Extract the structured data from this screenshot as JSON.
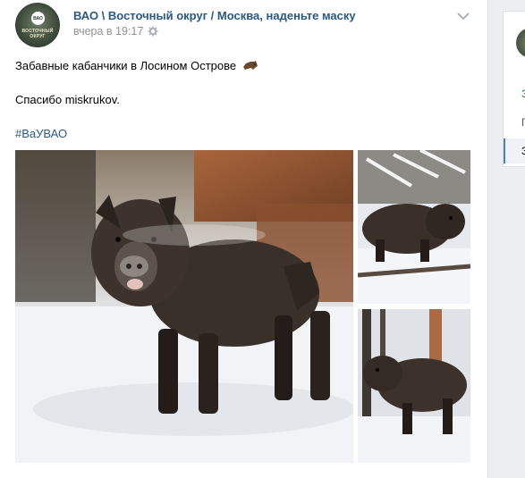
{
  "post": {
    "author": "ВАО \\ Восточный округ / Москва, наденьте маску",
    "avatar_badge": "ВАО",
    "avatar_caption": "ВОСТОЧНЫЙ ОКРУГ",
    "date": "вчера в 19:17",
    "text_line1": "Забавные кабанчики в Лосином Острове",
    "text_line2": "Спасибо miskrukov.",
    "hashtag": "#ВаУВАО",
    "icons": {
      "settings": "gear-icon",
      "more": "chevron-down-icon",
      "emoji": "boar-emoji-icon"
    },
    "photos": [
      {
        "name": "photo-boar-large",
        "subject": "wild boar in snow, front view"
      },
      {
        "name": "photo-boar-side",
        "subject": "wild boar walking in snow"
      },
      {
        "name": "photo-boar-forest",
        "subject": "wild boar in snowy forest"
      }
    ]
  },
  "sidebar": {
    "items": [
      "З",
      "Г",
      "З"
    ]
  },
  "colors": {
    "link": "#2a5885",
    "meta": "#939393",
    "page_bg": "#edeef0",
    "active_marker": "#5181b8"
  }
}
